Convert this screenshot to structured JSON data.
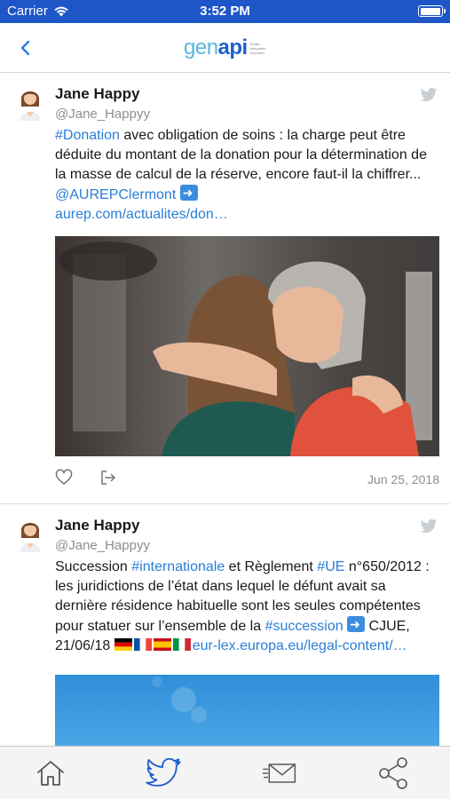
{
  "status_bar": {
    "carrier": "Carrier",
    "time": "3:52 PM",
    "battery_level": 1.0
  },
  "nav": {
    "back_icon": "chevron-left-icon",
    "logo": {
      "part1": "gen",
      "part2": "api",
      "tagline": "Smart Integrated Solutions"
    }
  },
  "tweets": [
    {
      "author": "Jane Happy",
      "handle": "@Jane_Happyy",
      "text": {
        "hashtag": "#Donation",
        "body": " avec obligation de soins : la charge peut être déduite du montant de la donation pour la détermination de la masse de calcul de la réserve, encore faut-il la chiffrer... ",
        "mention": "@AUREPClermont",
        "link": "aurep.com/actualites/don…"
      },
      "media_icon": "photo-two-women-hugging",
      "date": "Jun 25, 2018"
    },
    {
      "author": "Jane Happy",
      "handle": "@Jane_Happyy",
      "text": {
        "part1": "Succession ",
        "hashtag1": "#internationale",
        "part2": " et Règlement ",
        "hashtag2": "#UE",
        "part3": " n°650/2012 : les juridictions de l’état dans lequel le défunt avait sa dernière résidence habituelle sont les seules compétentes pour statuer sur l’ensemble de la ",
        "hashtag3": "#succession",
        "part4": " CJUE, 21/06/18 ",
        "link": "eur-lex.europa.eu/legal-content/…"
      },
      "media_icon": "photo-blue-sky"
    }
  ],
  "tab_bar": {
    "tabs": [
      "home-icon",
      "twitter-icon",
      "mail-icon",
      "share-icon"
    ],
    "active_color": "#1d5fcf"
  },
  "colors": {
    "status_bar": "#1e56c8",
    "link": "#2a7ed6"
  }
}
